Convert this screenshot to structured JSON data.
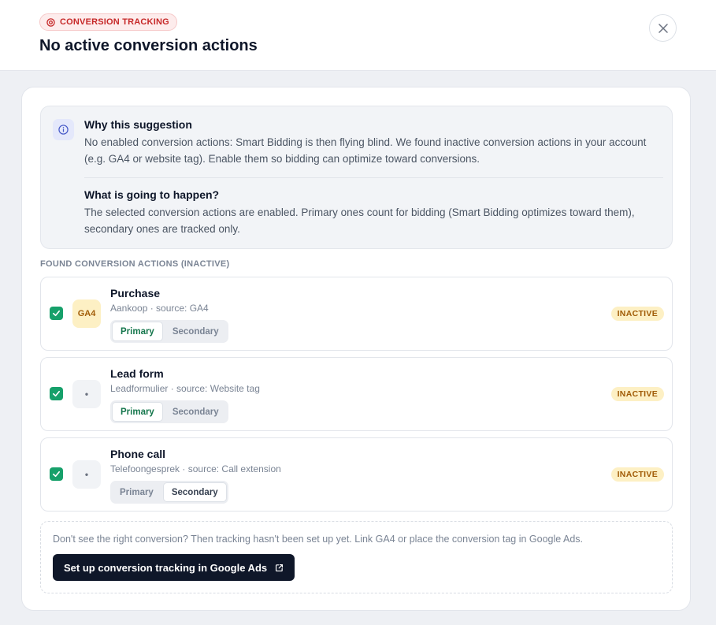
{
  "header": {
    "badge": "CONVERSION TRACKING",
    "title": "No active conversion actions"
  },
  "info": {
    "why_heading": "Why this suggestion",
    "why_text": "No enabled conversion actions: Smart Bidding is then flying blind. We found inactive conversion actions in your account (e.g. GA4 or website tag). Enable them so bidding can optimize toward conversions.",
    "what_heading": "What is going to happen?",
    "what_text": "The selected conversion actions are enabled. Primary ones count for bidding (Smart Bidding optimizes toward them), secondary ones are tracked only."
  },
  "section_label": "FOUND CONVERSION ACTIONS (INACTIVE)",
  "actions": [
    {
      "name": "Purchase",
      "meta": "Aankoop · source: GA4",
      "tile": "GA4",
      "checked": true,
      "primary_label": "Primary",
      "secondary_label": "Secondary",
      "selected": "Primary",
      "status": "INACTIVE"
    },
    {
      "name": "Lead form",
      "meta": "Leadformulier · source: Website tag",
      "tile": "•",
      "checked": true,
      "primary_label": "Primary",
      "secondary_label": "Secondary",
      "selected": "Primary",
      "status": "INACTIVE"
    },
    {
      "name": "Phone call",
      "meta": "Telefoongesprek · source: Call extension",
      "tile": "•",
      "checked": true,
      "primary_label": "Primary",
      "secondary_label": "Secondary",
      "selected": "Secondary",
      "status": "INACTIVE"
    }
  ],
  "help": {
    "text": "Don't see the right conversion? Then tracking hasn't been set up yet. Link GA4 or place the conversion tag in Google Ads.",
    "button_label": "Set up conversion tracking in Google Ads"
  },
  "colors": {
    "badge_red": "#c62828",
    "check_green": "#16a06a",
    "inactive_amber": "#a15c07",
    "button_dark": "#0f1729"
  },
  "icons": {
    "badge": "target-icon",
    "close": "close-icon",
    "info": "info-icon",
    "check": "check-icon",
    "external": "external-link-icon"
  }
}
